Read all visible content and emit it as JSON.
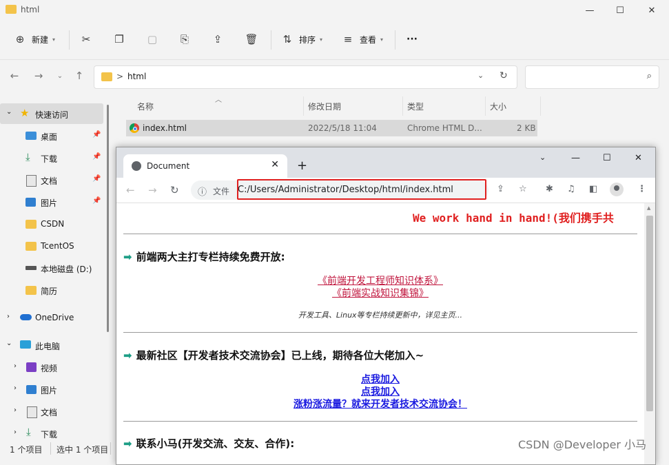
{
  "explorer": {
    "title": "html",
    "toolbar": {
      "new_label": "新建",
      "sort_label": "排序",
      "view_label": "查看",
      "more_label": "···"
    },
    "breadcrumb": {
      "separator": ">",
      "current": "html"
    },
    "sidebar": {
      "quick_access": "快速访问",
      "items": [
        {
          "label": "桌面",
          "icon": "desktop-icon",
          "pinned": true
        },
        {
          "label": "下载",
          "icon": "download-icon",
          "pinned": true
        },
        {
          "label": "文档",
          "icon": "document-icon",
          "pinned": true
        },
        {
          "label": "图片",
          "icon": "picture-icon",
          "pinned": true
        },
        {
          "label": "CSDN",
          "icon": "folder-icon",
          "pinned": false
        },
        {
          "label": "TcentOS",
          "icon": "folder-icon",
          "pinned": false
        },
        {
          "label": "本地磁盘 (D:)",
          "icon": "drive-icon",
          "pinned": false
        },
        {
          "label": "简历",
          "icon": "folder-icon",
          "pinned": false
        }
      ],
      "onedrive": "OneDrive",
      "this_pc": "此电脑",
      "pc_items": [
        {
          "label": "视频",
          "icon": "video-icon"
        },
        {
          "label": "图片",
          "icon": "picture-icon"
        },
        {
          "label": "文档",
          "icon": "document-icon"
        },
        {
          "label": "下载",
          "icon": "download-icon"
        }
      ]
    },
    "columns": [
      "名称",
      "修改日期",
      "类型",
      "大小"
    ],
    "files": [
      {
        "name": "index.html",
        "modified": "2022/5/18 11:04",
        "type": "Chrome HTML D...",
        "size": "2 KB"
      }
    ],
    "status": {
      "count": "1 个项目",
      "selected": "选中 1 个项目"
    }
  },
  "chrome": {
    "tab_title": "Document",
    "omnibox_label": "文件",
    "url": "C:/Users/Administrator/Desktop/html/index.html"
  },
  "page": {
    "marquee": "We work hand in hand!(我们携手共",
    "section1": {
      "heading": "前端两大主打专栏持续免费开放:",
      "links": [
        "《前端开发工程师知识体系》",
        "《前端实战知识集锦》"
      ],
      "note": "开发工具、Linux等专栏持续更新中，详见主页..."
    },
    "section2": {
      "heading": "最新社区【开发者技术交流协会】已上线，期待各位大佬加入~",
      "links": [
        "点我加入",
        "点我加入",
        "涨粉涨流量？就来开发者技术交流协会！"
      ]
    },
    "section3": {
      "heading": "联系小马(开发交流、交友、合作):"
    }
  },
  "watermark": "CSDN @Developer 小马",
  "colors": {
    "accent_red": "#e02020",
    "link_red": "#c0143c",
    "link_blue": "#1a1ae0",
    "arrow_green": "#1d9e86"
  }
}
